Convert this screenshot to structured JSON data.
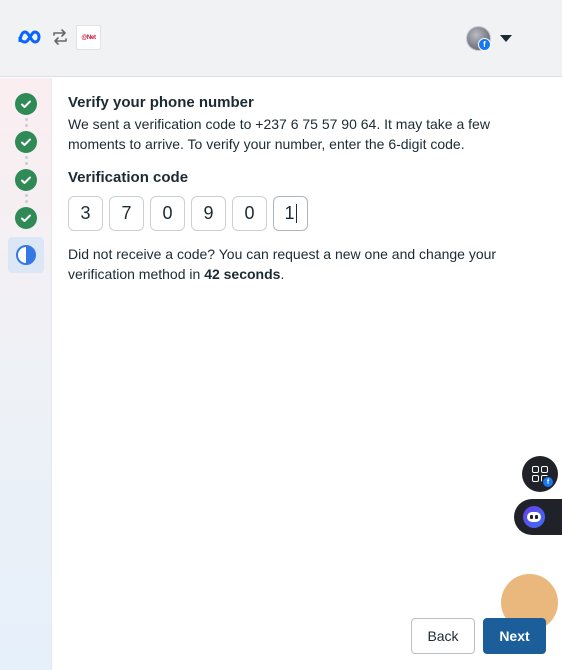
{
  "header": {
    "brand_icon": "meta-logo-icon",
    "swap_icon": "swap-arrows-icon",
    "business_logo_text": "@Net",
    "avatar_badge_icon": "facebook-icon",
    "menu_icon": "caret-down-icon"
  },
  "sidebar": {
    "steps": [
      {
        "status": "complete",
        "icon": "check-icon"
      },
      {
        "status": "complete",
        "icon": "check-icon"
      },
      {
        "status": "complete",
        "icon": "check-icon"
      },
      {
        "status": "complete",
        "icon": "check-icon"
      },
      {
        "status": "current",
        "icon": "half-circle-icon"
      }
    ],
    "complete_color": "#2f8a56",
    "current_color": "#3578e5"
  },
  "main": {
    "title": "Verify your phone number",
    "description": "We sent a verification code to +237 6 75 57 90 64. It may take a few moments to arrive. To verify your number, enter the 6-digit code.",
    "code_label": "Verification code",
    "code_digits": [
      "3",
      "7",
      "0",
      "9",
      "0",
      "1"
    ],
    "resend_prefix": "Did not receive a code? You can request a new one and change your verification method in ",
    "resend_time": "42 seconds",
    "resend_suffix": "."
  },
  "floating": {
    "apps_icon": "apps-grid-icon",
    "assistant_icon": "assistant-bot-icon"
  },
  "footer": {
    "back_label": "Back",
    "next_label": "Next",
    "next_color": "#1b5e99"
  }
}
